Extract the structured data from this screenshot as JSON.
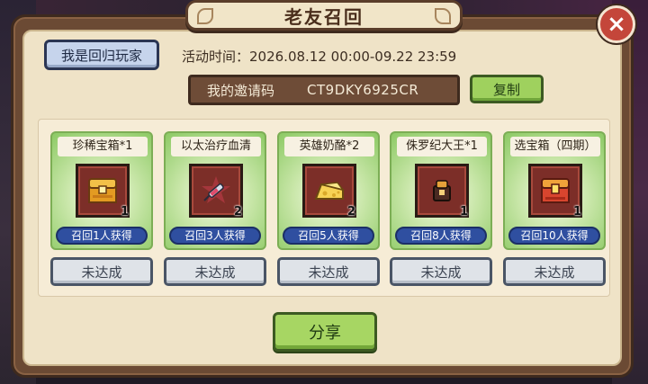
{
  "title": "老友召回",
  "close_label": "×",
  "returning_button": "我是回归玩家",
  "activity_time": "活动时间：2026.08.12 00:00-09.22 23:59",
  "invite": {
    "label": "我的邀请码",
    "code": "CT9DKY6925CR",
    "copy_label": "复制"
  },
  "rewards": [
    {
      "name": "珍稀宝箱*1",
      "count": "1",
      "condition": "召回1人获得",
      "status": "未达成",
      "icon": "rare-chest-icon"
    },
    {
      "name": "以太治疗血清",
      "count": "2",
      "condition": "召回3人获得",
      "status": "未达成",
      "icon": "syringe-icon"
    },
    {
      "name": "英雄奶酪*2",
      "count": "2",
      "condition": "召回5人获得",
      "status": "未达成",
      "icon": "cheese-icon"
    },
    {
      "name": "侏罗纪大王*1",
      "count": "1",
      "condition": "召回8人获得",
      "status": "未达成",
      "icon": "creature-icon"
    },
    {
      "name": "选宝箱（四期）",
      "count": "1",
      "condition": "召回10人获得",
      "status": "未达成",
      "icon": "choice-chest-icon"
    }
  ],
  "share_label": "分享",
  "colors": {
    "panel_bg": "#efe3c7",
    "panel_border": "#6b4a34",
    "green_button": "#a7d663",
    "blue_button": "#c6d4ec",
    "condition_badge": "#2f4fa0",
    "close_button": "#c4463a"
  }
}
